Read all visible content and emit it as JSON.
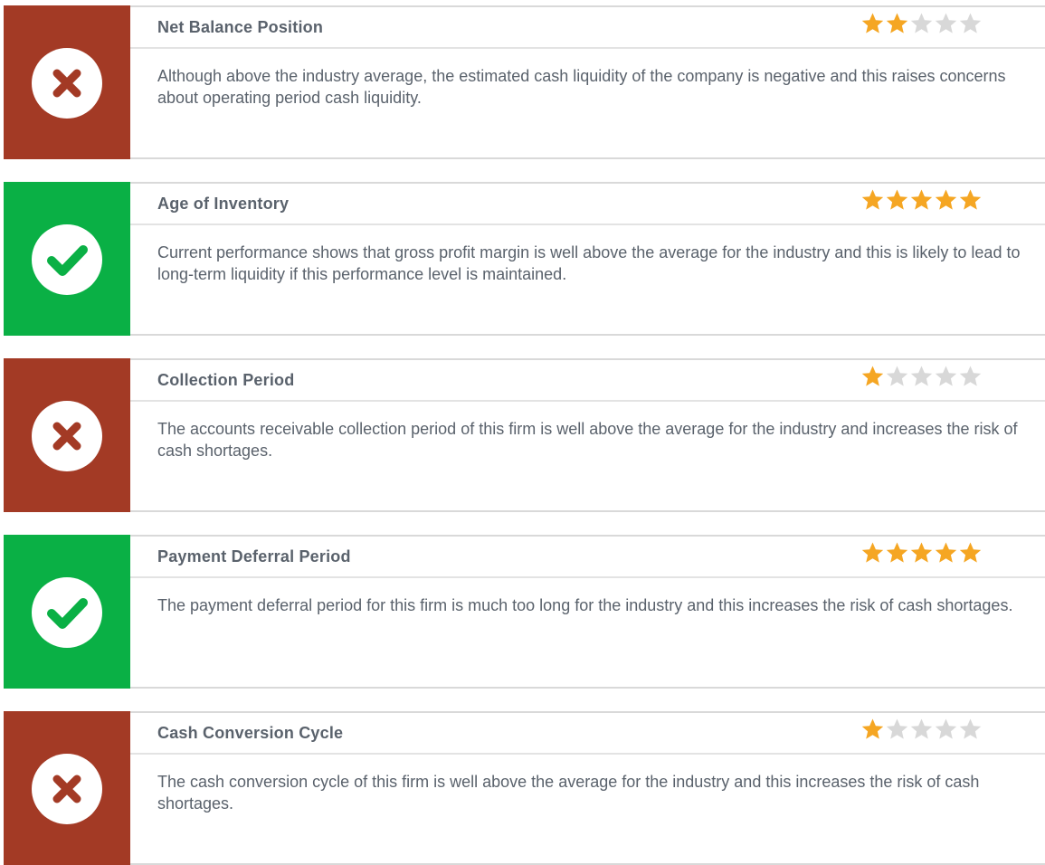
{
  "colors": {
    "negative": "#a33a25",
    "positive": "#0ab045",
    "star_filled": "#f5a623",
    "star_empty": "#d8d8d8"
  },
  "cards": [
    {
      "status": "negative",
      "icon": "x-icon",
      "title": "Net Balance Position",
      "rating": 2,
      "max_rating": 5,
      "description": "Although above the industry average, the estimated cash liquidity of the company is negative and this raises concerns about operating period cash liquidity."
    },
    {
      "status": "positive",
      "icon": "check-icon",
      "title": "Age of Inventory",
      "rating": 5,
      "max_rating": 5,
      "description": "Current performance shows that gross profit margin is well above the average for the industry and this is likely to lead to long-term liquidity if this performance level is maintained."
    },
    {
      "status": "negative",
      "icon": "x-icon",
      "title": "Collection Period",
      "rating": 1,
      "max_rating": 5,
      "description": "The accounts receivable collection period of this firm is well above the average for the industry and increases the risk of cash shortages."
    },
    {
      "status": "positive",
      "icon": "check-icon",
      "title": "Payment Deferral Period",
      "rating": 5,
      "max_rating": 5,
      "description": "The payment deferral period for this firm is much too long for the industry and this increases the risk of cash shortages."
    },
    {
      "status": "negative",
      "icon": "x-icon",
      "title": "Cash Conversion Cycle",
      "rating": 1,
      "max_rating": 5,
      "description": "The cash conversion cycle of this firm is well above the average for the industry and this increases the risk of cash shortages."
    }
  ]
}
